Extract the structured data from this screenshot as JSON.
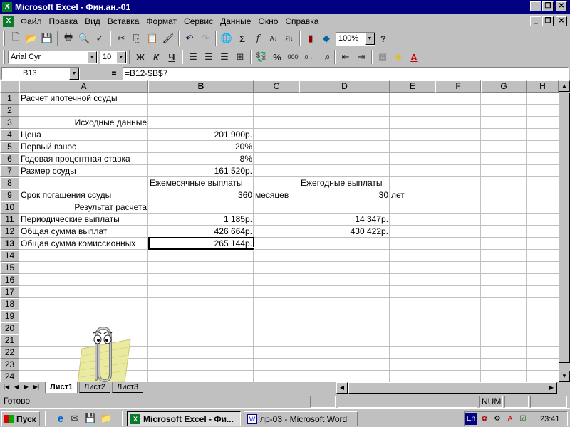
{
  "window": {
    "title": "Microsoft Excel - Фин.ан.-01"
  },
  "menu": [
    "Файл",
    "Правка",
    "Вид",
    "Вставка",
    "Формат",
    "Сервис",
    "Данные",
    "Окно",
    "Справка"
  ],
  "toolbar": {
    "zoom": "100%"
  },
  "format_toolbar": {
    "font": "Arial Cyr",
    "size": "10",
    "bold": "Ж",
    "italic": "К",
    "underline": "Ч"
  },
  "formula_bar": {
    "name_box": "B13",
    "eq": "=",
    "formula": "=B12-$B$7"
  },
  "columns": [
    "A",
    "B",
    "C",
    "D",
    "E",
    "F",
    "G",
    "H"
  ],
  "rows": [
    "1",
    "2",
    "3",
    "4",
    "5",
    "6",
    "7",
    "8",
    "9",
    "10",
    "11",
    "12",
    "13",
    "14",
    "15",
    "16",
    "17",
    "18",
    "19",
    "20",
    "21",
    "22",
    "23",
    "24"
  ],
  "cells": {
    "A1": "Расчет ипотечной ссуды",
    "A3": "Исходные данные",
    "A4": "Цена",
    "B4": "201 900р.",
    "A5": "Первый взнос",
    "B5": "20%",
    "A6": "Годовая процентная ставка",
    "B6": "8%",
    "A7": "Размер ссуды",
    "B7": "161 520р.",
    "B8": "Ежемесячные выплаты",
    "D8": "Ежегодные выплаты",
    "A9": "Срок погашения ссуды",
    "B9": "360",
    "C9": "месяцев",
    "D9": "30",
    "E9": "лет",
    "A10": "Результат расчета",
    "A11": "Периодические выплаты",
    "B11": "1 185р.",
    "D11": "14 347р.",
    "A12": "Общая сумма выплат",
    "B12": "426 664р.",
    "D12": "430 422р.",
    "A13": "Общая сумма комиссионных",
    "B13": "265 144р."
  },
  "sheet_tabs": [
    "Лист1",
    "Лист2",
    "Лист3"
  ],
  "status": {
    "text": "Готово",
    "num": "NUM"
  },
  "taskbar": {
    "start": "Пуск",
    "windows": [
      "Microsoft Excel - Фи...",
      "лр-03 - Microsoft Word"
    ],
    "lang": "En",
    "clock": "23:41"
  },
  "colors": {
    "titlebar": "#000080",
    "chrome": "#c0c0c0",
    "grid": "#c0c0c0"
  }
}
